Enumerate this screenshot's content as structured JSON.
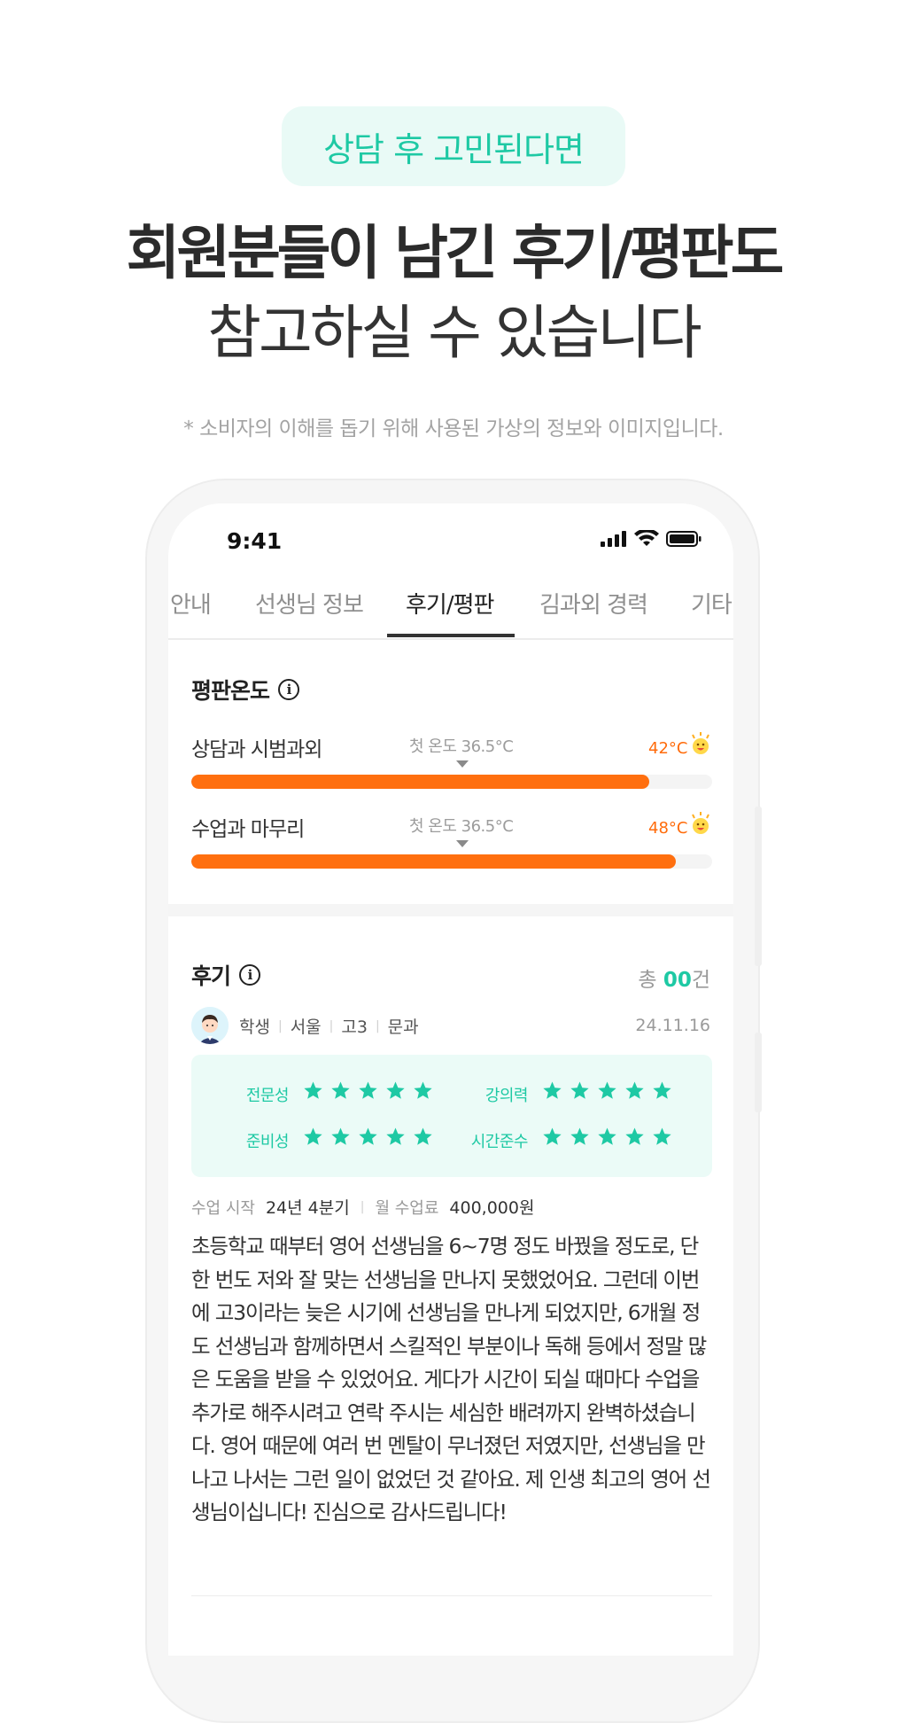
{
  "header": {
    "pill_text": "상담 후 고민된다면",
    "headline": "회원분들이 남긴 후기/평판도",
    "subline": "참고하실 수 있습니다",
    "disclaimer": "* 소비자의 이해를 돕기 위해 사용된 가상의 정보와 이미지입니다."
  },
  "status_bar": {
    "time": "9:41",
    "icons": [
      "signal-icon",
      "wifi-icon",
      "battery-icon"
    ]
  },
  "tabs": [
    {
      "label": "안내",
      "active": false
    },
    {
      "label": "선생님 정보",
      "active": false
    },
    {
      "label": "후기/평판",
      "active": true
    },
    {
      "label": "김과외 경력",
      "active": false
    },
    {
      "label": "기타",
      "active": false
    }
  ],
  "reputation": {
    "title": "평판온도",
    "rows": [
      {
        "label": "상담과 시범과외",
        "first_temp": "첫 온도 36.5°C",
        "value": "42°C",
        "fill": 0.88
      },
      {
        "label": "수업과 마무리",
        "first_temp": "첫 온도 36.5°C",
        "value": "48°C",
        "fill": 0.93
      }
    ]
  },
  "reviews": {
    "title": "후기",
    "count_prefix": "총 ",
    "count": "00",
    "count_suffix": "건",
    "item": {
      "meta": [
        "학생",
        "서울",
        "고3",
        "문과"
      ],
      "date": "24.11.16",
      "ratings": [
        {
          "label": "전문성",
          "stars": 5
        },
        {
          "label": "강의력",
          "stars": 5
        },
        {
          "label": "준비성",
          "stars": 5
        },
        {
          "label": "시간준수",
          "stars": 5
        }
      ],
      "start_label": "수업 시작",
      "start_value": "24년 4분기",
      "fee_label": "월 수업료",
      "fee_value": "400,000원",
      "text": "초등학교 때부터 영어 선생님을 6~7명 정도 바꿨을 정도로, 단 한 번도 저와 잘 맞는 선생님을 만나지 못했었어요. 그런데 이번에 고3이라는 늦은 시기에 선생님을 만나게 되었지만, 6개월 정도 선생님과 함께하면서 스킬적인 부분이나 독해 등에서 정말 많은 도움을 받을 수 있었어요. 게다가 시간이 되실 때마다 수업을 추가로 해주시려고 연락 주시는 세심한 배려까지 완벽하셨습니다. 영어 때문에 여러 번 멘탈이 무너졌던 저였지만, 선생님을 만나고 나서는 그런 일이 없었던 것 같아요. 제 인생 최고의 영어 선생님이십니다! 진심으로 감사드립니다!"
    }
  },
  "colors": {
    "accent": "#1ec9a4",
    "progress": "#ff6f0f",
    "rating_bg": "#ebfbf7"
  }
}
